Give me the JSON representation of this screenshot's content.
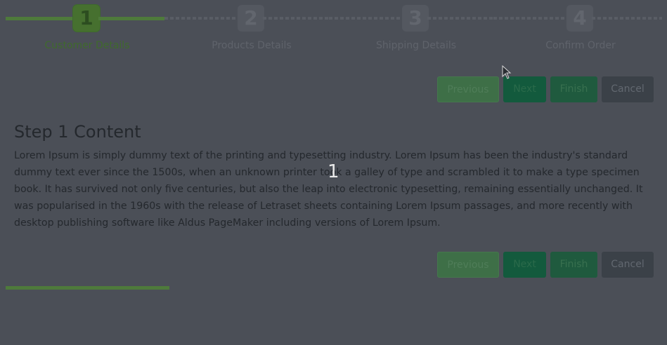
{
  "stepper": {
    "steps": [
      {
        "number": "1",
        "label": "Customer Details",
        "active": true
      },
      {
        "number": "2",
        "label": "Products Details",
        "active": false
      },
      {
        "number": "3",
        "label": "Shipping Details",
        "active": false
      },
      {
        "number": "4",
        "label": "Confirm Order",
        "active": false
      }
    ]
  },
  "toolbar": {
    "previous_label": "Previous",
    "next_label": "Next",
    "finish_label": "Finish",
    "cancel_label": "Cancel"
  },
  "content": {
    "title": "Step 1 Content",
    "body": "Lorem Ipsum is simply dummy text of the printing and typesetting industry. Lorem Ipsum has been the industry's standard dummy text ever since the 1500s, when an unknown printer took a galley of type and scrambled it to make a type specimen book. It has survived not only five centuries, but also the leap into electronic typesetting, remaining essentially unchanged. It was popularised in the 1960s with the release of Letraset sheets containing Lorem Ipsum passages, and more recently with desktop publishing software like Aldus PageMaker including versions of Lorem Ipsum."
  },
  "overlay": {
    "step_indicator": "1"
  },
  "progress": {
    "fraction": 0.25
  },
  "colors": {
    "background": "#4b4f57",
    "active_green": "#4e7a3b",
    "next_button": "#135a3d",
    "cancel_button": "#3b4148"
  },
  "icons": {
    "cursor": "mouse-pointer-icon"
  }
}
